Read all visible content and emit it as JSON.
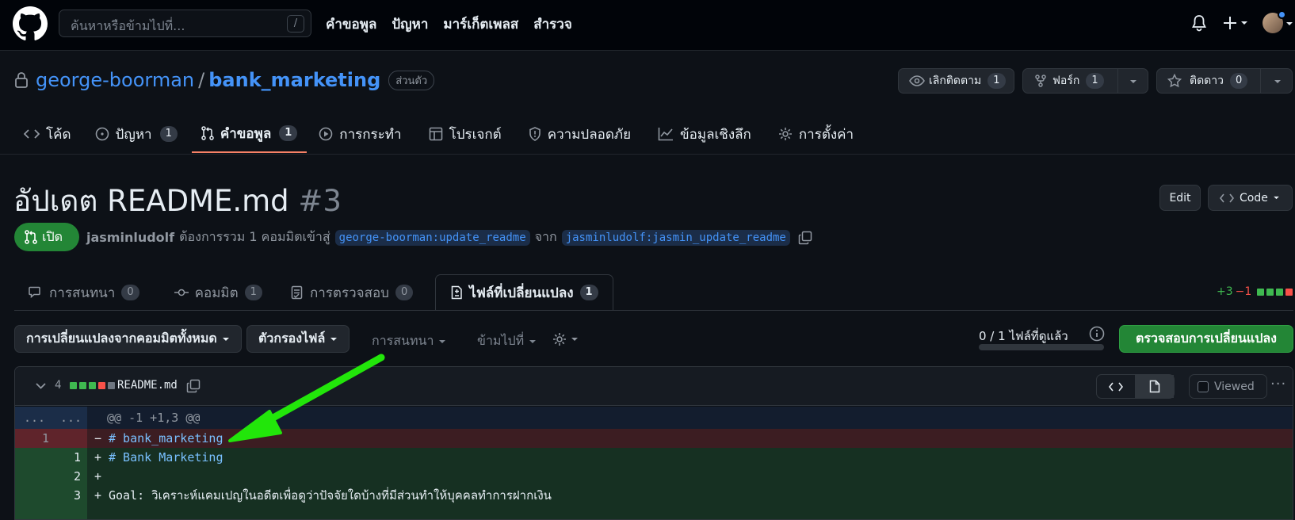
{
  "header": {
    "search_placeholder": "ค้นหาหรือข้ามไปที่...",
    "search_shortcut": "/",
    "nav": [
      "คำขอพูล",
      "ปัญหา",
      "มาร์เก็ตเพลส",
      "สำรวจ"
    ]
  },
  "repo": {
    "owner": "george-boorman",
    "separator": "/",
    "name": "bank_marketing",
    "visibility": "ส่วนตัว",
    "unwatch_label": "เลิกติดตาม",
    "unwatch_count": "1",
    "fork_label": "ฟอร์ก",
    "fork_count": "1",
    "star_label": "ติดดาว",
    "star_count": "0"
  },
  "repo_tabs": [
    {
      "label": "โค้ด",
      "count": ""
    },
    {
      "label": "ปัญหา",
      "count": "1"
    },
    {
      "label": "คำขอพูล",
      "count": "1"
    },
    {
      "label": "การกระทำ",
      "count": ""
    },
    {
      "label": "โปรเจกต์",
      "count": ""
    },
    {
      "label": "ความปลอดภัย",
      "count": ""
    },
    {
      "label": "ข้อมูลเชิงลึก",
      "count": ""
    },
    {
      "label": "การตั้งค่า",
      "count": ""
    }
  ],
  "pr": {
    "title": "อัปเดต README.md",
    "number": "#3",
    "edit_label": "Edit",
    "code_label": "Code",
    "state": "เปิด",
    "author": "jasminludolf",
    "message": "ต้องการรวม 1 คอมมิตเข้าสู่",
    "base_branch": "george-boorman:update_readme",
    "from_word": "จาก",
    "head_branch": "jasminludolf:jasmin_update_readme"
  },
  "pr_tabs": [
    {
      "label": "การสนทนา",
      "count": "0"
    },
    {
      "label": "คอมมิต",
      "count": "1"
    },
    {
      "label": "การตรวจสอบ",
      "count": "0"
    },
    {
      "label": "ไฟล์ที่เปลี่ยนแปลง",
      "count": "1"
    }
  ],
  "diffstat": {
    "additions": "+3",
    "deletions": "−1"
  },
  "toolbar": {
    "changes_from": "การเปลี่ยนแปลงจากคอมมิตทั้งหมด",
    "file_filter": "ตัวกรองไฟล์",
    "conversations": "การสนทนา",
    "jump_to": "ข้ามไปที่",
    "viewed_progress": "0 / 1 ไฟล์ที่ดูแล้ว",
    "review_button": "ตรวจสอบการเปลี่ยนแปลง"
  },
  "file": {
    "change_count": "4",
    "name": "README.md",
    "viewed_label": "Viewed",
    "hunk_header": "@@ -1 +1,3 @@",
    "expand_marker": "...",
    "lines": [
      {
        "type": "del",
        "old": "1",
        "new": "",
        "sign": "−",
        "text": "# bank_marketing"
      },
      {
        "type": "add",
        "old": "",
        "new": "1",
        "sign": "+",
        "text": "# Bank Marketing"
      },
      {
        "type": "add",
        "old": "",
        "new": "2",
        "sign": "+",
        "text": ""
      },
      {
        "type": "add",
        "old": "",
        "new": "3",
        "sign": "+",
        "text": "Goal: วิเคราะห์แคมเปญในอดีตเพื่อดูว่าปัจจัยใดบ้างที่มีส่วนทำให้บุคคลทำการฝากเงิน"
      }
    ]
  },
  "colors": {
    "accent_green": "#238636",
    "arrow_green": "#22e60a",
    "tab_underline": "#f78166",
    "link_blue": "#4493f8"
  }
}
